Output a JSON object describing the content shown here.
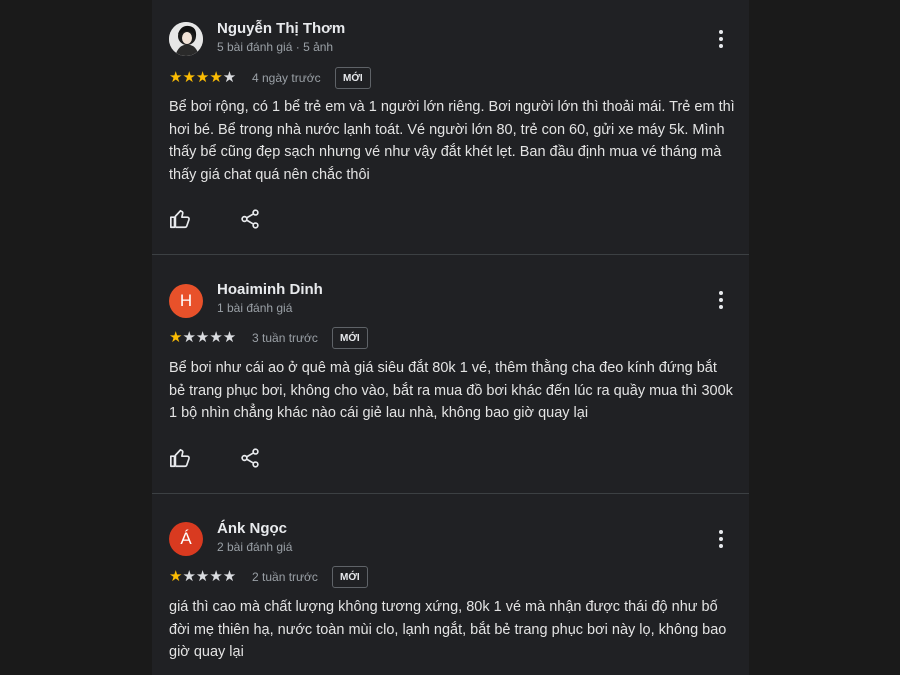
{
  "reviews": [
    {
      "name": "Nguyễn Thị Thơm",
      "meta": "5 bài đánh giá · 5 ảnh",
      "rating": 4,
      "stars": "★★★★★",
      "age": "4 ngày trước",
      "badge": "MỚI",
      "text": "Bể bơi rộng, có 1 bể trẻ em và 1 người lớn riêng. Bơi người lớn thì thoải mái. Trẻ em thì hơi bé. Bể trong nhà nước lạnh toát. Vé người lớn 80, trẻ con 60, gửi xe máy 5k. Mình thấy bể cũng đẹp sạch nhưng vé như vậy đắt khét lẹt. Ban đầu định mua vé tháng mà thấy giá chat quá nên chắc thôi"
    },
    {
      "name": "Hoaiminh Dinh",
      "meta": "1 bài đánh giá",
      "avatar_letter": "H",
      "rating": 1,
      "stars": "★★★★★",
      "age": "3 tuần trước",
      "badge": "MỚI",
      "text": "Bể bơi như cái ao ở quê mà giá siêu đắt 80k 1 vé, thêm thằng cha đeo kính đứng bắt bẻ trang phục bơi, không cho vào, bắt ra mua đồ bơi khác đến lúc ra quầy mua thì 300k 1 bộ nhìn chẳng khác nào cái giẻ lau nhà, không bao giờ quay lại"
    },
    {
      "name": "Ánk Ngọc",
      "meta": "2 bài đánh giá",
      "avatar_letter": "Á",
      "rating": 1,
      "stars": "★★★★★",
      "age": "2 tuần trước",
      "badge": "MỚI",
      "text": "giá thì cao mà chất lượng không tương xứng, 80k 1 vé mà nhận được thái độ như bố đời mẹ thiên hạ, nước toàn mùi clo, lạnh ngắt, bắt bẻ trang phục bơi này lọ, không bao giờ quay lại"
    }
  ],
  "colors": {
    "star_on": "#fbbc04",
    "star_off": "#dadce0",
    "avatar_h": "#e8512a",
    "avatar_a": "#d93a20",
    "panel_bg": "#202124"
  },
  "icons": [
    "thumb-up-icon",
    "share-icon",
    "more-vert-icon"
  ]
}
